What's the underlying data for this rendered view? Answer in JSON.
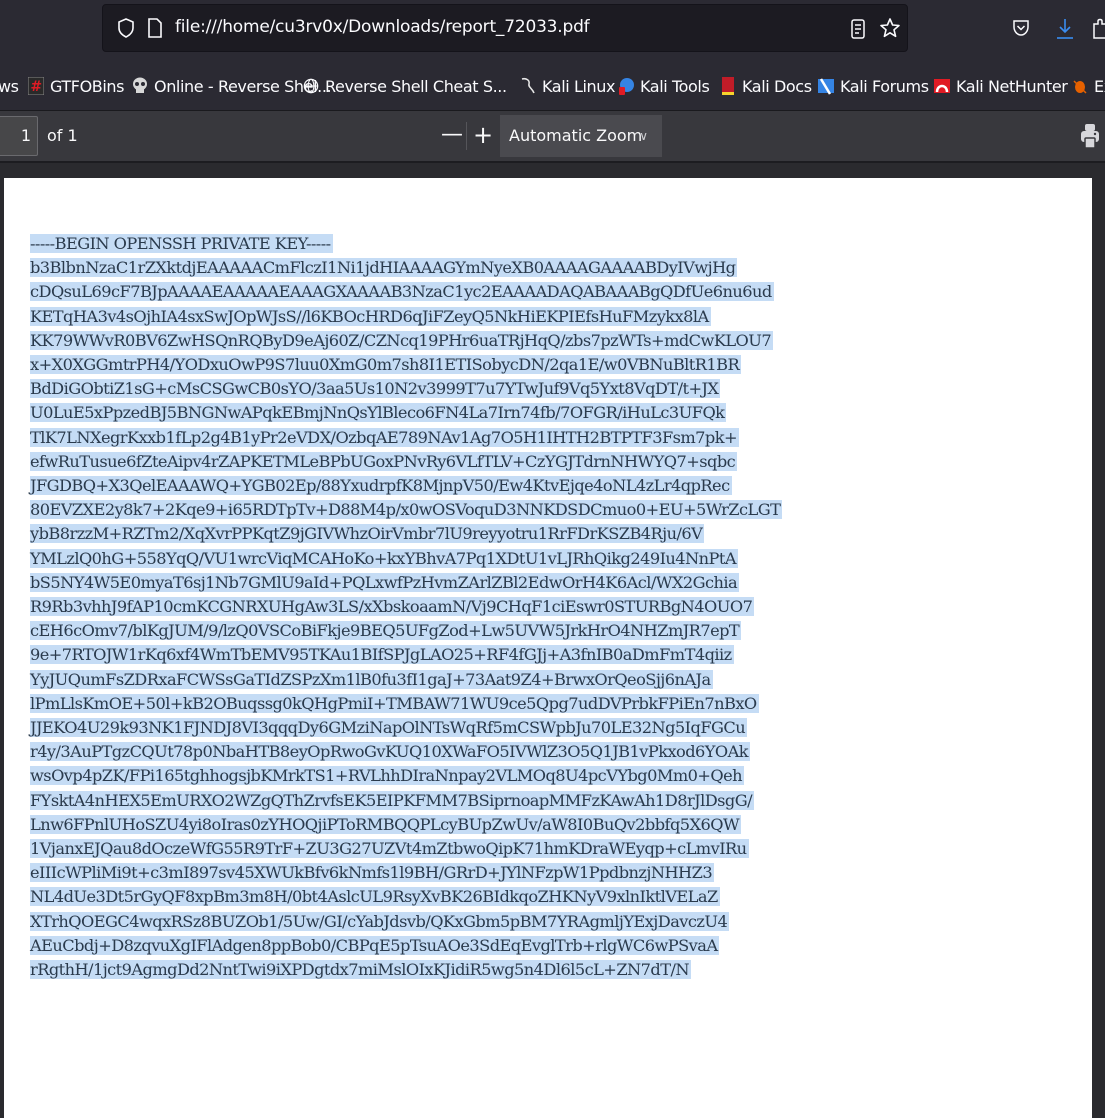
{
  "browser": {
    "url": "file:///home/cu3rv0x/Downloads/report_72033.pdf",
    "icons": {
      "tracking_protection": "shield-icon",
      "page_info": "page-icon",
      "reader_view": "reader-view-icon",
      "bookmark": "star-icon",
      "pocket": "pocket-icon",
      "downloads": "download-icon",
      "extensions": "extensions-icon"
    },
    "bookmarks": [
      {
        "label": "ws",
        "icon": "none"
      },
      {
        "label": "GTFOBins",
        "icon": "gtfobins-icon"
      },
      {
        "label": "Online - Reverse Shel...",
        "icon": "skull-icon"
      },
      {
        "label": "Reverse Shell Cheat S...",
        "icon": "globe-icon"
      },
      {
        "label": "Kali Linux",
        "icon": "kali-dragon-icon"
      },
      {
        "label": "Kali Tools",
        "icon": "kali-tools-icon"
      },
      {
        "label": "Kali Docs",
        "icon": "kali-docs-icon"
      },
      {
        "label": "Kali Forums",
        "icon": "kali-forums-icon"
      },
      {
        "label": "Kali NetHunter",
        "icon": "kali-nethunter-icon"
      },
      {
        "label": "Ex",
        "icon": "exploit-db-icon"
      }
    ]
  },
  "pdf_toolbar": {
    "page_number": "1",
    "page_count": "of 1",
    "zoom_out": "—",
    "zoom_in": "+",
    "zoom_level": "Automatic Zoom",
    "print_icon": "print-icon"
  },
  "document": {
    "lines": [
      "-----BEGIN OPENSSH PRIVATE KEY-----",
      "b3BlbnNzaC1rZXktdjEAAAAACmFlczI1Ni1jdHIAAAAGYmNyeXB0AAAAGAAAABDyIVwjHg",
      "cDQsuL69cF7BJpAAAAEAAAAAEAAAGXAAAAB3NzaC1yc2EAAAADAQABAAABgQDfUe6nu6ud",
      "KETqHA3v4sOjhIA4sxSwJOpWJsS//l6KBOcHRD6qJiFZeyQ5NkHiEKPIEfsHuFMzykx8lA",
      "KK79WWvR0BV6ZwHSQnRQByD9eAj60Z/CZNcq19PHr6uaTRjHqQ/zbs7pzWTs+mdCwKLOU7",
      "x+X0XGGmtrPH4/YODxuOwP9S7luu0XmG0m7sh8I1ETISobycDN/2qa1E/w0VBNuBltR1BR",
      "BdDiGObtiZ1sG+cMsCSGwCB0sYO/3aa5Us10N2v3999T7u7YTwJuf9Vq5Yxt8VqDT/t+JX",
      "U0LuE5xPpzedBJ5BNGNwAPqkEBmjNnQsYlBleco6FN4La7Irn74fb/7OFGR/iHuLc3UFQk",
      "TlK7LNXegrKxxb1fLp2g4B1yPr2eVDX/OzbqAE789NAv1Ag7O5H1IHTH2BTPTF3Fsm7pk+",
      "efwRuTusue6fZteAipv4rZAPKETMLeBPbUGoxPNvRy6VLfTLV+CzYGJTdrnNHWYQ7+sqbc",
      "JFGDBQ+X3QelEAAAWQ+YGB02Ep/88YxudrpfK8MjnpV50/Ew4KtvEjqe4oNL4zLr4qpRec",
      "80EVZXE2y8k7+2Kqe9+i65RDTpTv+D88M4p/x0wOSVoquD3NNKDSDCmuo0+EU+5WrZcLGT",
      "ybB8rzzM+RZTm2/XqXvrPPKqtZ9jGIVWhzOirVmbr7lU9reyyotru1RrFDrKSZB4Rju/6V",
      "YMLzlQ0hG+558YqQ/VU1wrcViqMCAHoKo+kxYBhvA7Pq1XDtU1vLJRhQikg249Iu4NnPtA",
      "bS5NY4W5E0myaT6sj1Nb7GMlU9aId+PQLxwfPzHvmZArlZBl2EdwOrH4K6Acl/WX2Gchia",
      "R9Rb3vhhJ9fAP10cmKCGNRXUHgAw3LS/xXbskoaamN/Vj9CHqF1ciEswr0STURBgN4OUO7",
      "cEH6cOmv7/blKgJUM/9/lzQ0VSCoBiFkje9BEQ5UFgZod+Lw5UVW5JrkHrO4NHZmJR7epT",
      "9e+7RTOJW1rKq6xf4WmTbEMV95TKAu1BIfSPJgLAO25+RF4fGJj+A3fnIB0aDmFmT4qiiz",
      "YyJUQumFsZDRxaFCWSsGaTIdZSPzXm1lB0fu3fI1gaJ+73Aat9Z4+BrwxOrQeoSjj6nAJa",
      "lPmLlsKmOE+50l+kB2OBuqssg0kQHgPmiI+TMBAW71WU9ce5Qpg7udDVPrbkFPiEn7nBxO",
      "JJEKO4U29k93NK1FJNDJ8VI3qqqDy6GMziNapOlNTsWqRf5mCSWpbJu70LE32Ng5IqFGCu",
      "r4y/3AuPTgzCQUt78p0NbaHTB8eyOpRwoGvKUQ10XWaFO5IVWlZ3O5Q1JB1vPkxod6YOAk",
      "wsOvp4pZK/FPi165tghhogsjbKMrkTS1+RVLhhDIraNnpay2VLMOq8U4pcVYbg0Mm0+Qeh",
      "FYsktA4nHEX5EmURXO2WZgQThZrvfsEK5EIPKFMM7BSiprnoapMMFzKAwAh1D8rJlDsgG/",
      "Lnw6FPnlUHoSZU4yi8oIras0zYHOQjiPToRMBQQPLcyBUpZwUv/aW8I0BuQv2bbfq5X6QW",
      "1VjanxEJQau8dOczeWfG55R9TrF+ZU3G27UZVt4mZtbwoQipK71hmKDraWEyqp+cLmvIRu",
      "eIIIcWPliMi9t+c3mI897sv45XWUkBfv6kNmfs1l9BH/GRrD+JYlNFzpW1PpdbnzjNHHZ3",
      "NL4dUe3Dt5rGyQF8xpBm3m8H/0bt4AslcUL9RsyXvBK26BIdkqoZHKNyV9xlnIktlVELaZ",
      "XTrhQOEGC4wqxRSz8BUZOb1/5Uw/GI/cYabJdsvb/QKxGbm5pBM7YRAgmljYExjDavczU4",
      "AEuCbdj+D8zqvuXgIFlAdgen8ppBob0/CBPqE5pTsuAOe3SdEqEvglTrb+rlgWC6wPSvaA",
      "rRgthH/1jct9AgmgDd2NntTwi9iXPDgtdx7miMslOIxKJidiR5wg5n4Dl6l5cL+ZN7dT/N"
    ]
  }
}
